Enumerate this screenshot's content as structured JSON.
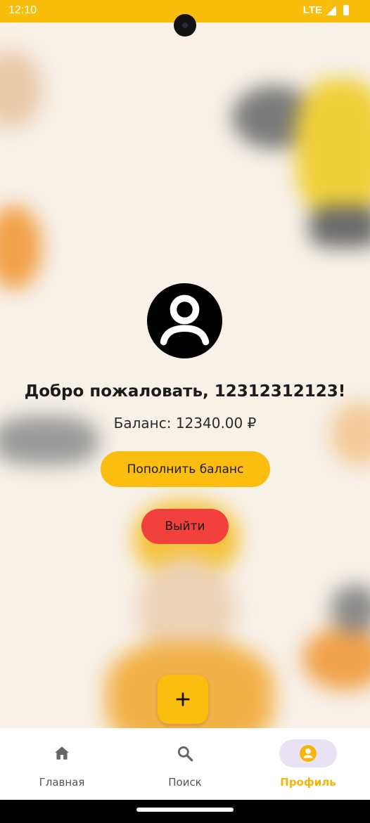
{
  "status_bar": {
    "time": "12:10",
    "network": "LTE"
  },
  "profile": {
    "welcome_text": "Добро пожаловать, 12312312123!",
    "balance_text": "Баланс: 12340.00 ₽",
    "topup_label": "Пополнить баланс",
    "logout_label": "Выйти"
  },
  "fab": {
    "icon": "plus-icon"
  },
  "bottom_nav": {
    "items": [
      {
        "label": "Главная",
        "icon": "home-icon",
        "active": false
      },
      {
        "label": "Поиск",
        "icon": "search-icon",
        "active": false
      },
      {
        "label": "Профиль",
        "icon": "account-circle-icon",
        "active": true
      }
    ]
  },
  "colors": {
    "accent": "#fbbd0f",
    "logout": "#f2403c",
    "active_indicator": "#e9e2f5",
    "background": "#f7f1e8"
  }
}
